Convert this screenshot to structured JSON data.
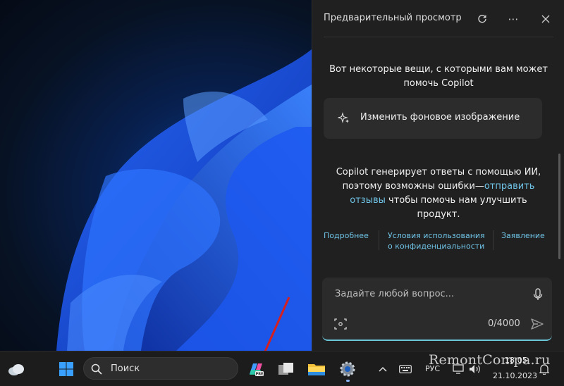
{
  "copilot": {
    "title": "Предварительный просмотр",
    "intro": "Вот некоторые вещи, с которыми вам может помочь Copilot",
    "suggestion": "Изменить фоновое изображение",
    "disclaimer_part1": "Copilot генерирует ответы с помощью ИИ, поэтому возможны ошибки—",
    "disclaimer_link": "отправить отзывы",
    "disclaimer_part2": " чтобы помочь нам улучшить продукт.",
    "links": {
      "more": "Подробнее",
      "terms": "Условия использования",
      "privacy": "о конфиденциальности",
      "statement": "Заявление"
    },
    "composer": {
      "placeholder": "Задайте любой вопрос...",
      "counter": "0/4000"
    }
  },
  "taskbar": {
    "search_label": "Поиск",
    "language": "РУС",
    "time": "18:05",
    "date": "21.10.2023"
  },
  "watermark": "RemontCompa.ru",
  "icons": {
    "refresh": "refresh-icon",
    "more": "more-icon",
    "close": "close-icon",
    "sparkle": "sparkle-icon",
    "mic": "microphone-icon",
    "send": "send-icon"
  },
  "colors": {
    "accent_link": "#6fc3e6",
    "pane_bg": "#202020",
    "arrow": "#d42020"
  }
}
